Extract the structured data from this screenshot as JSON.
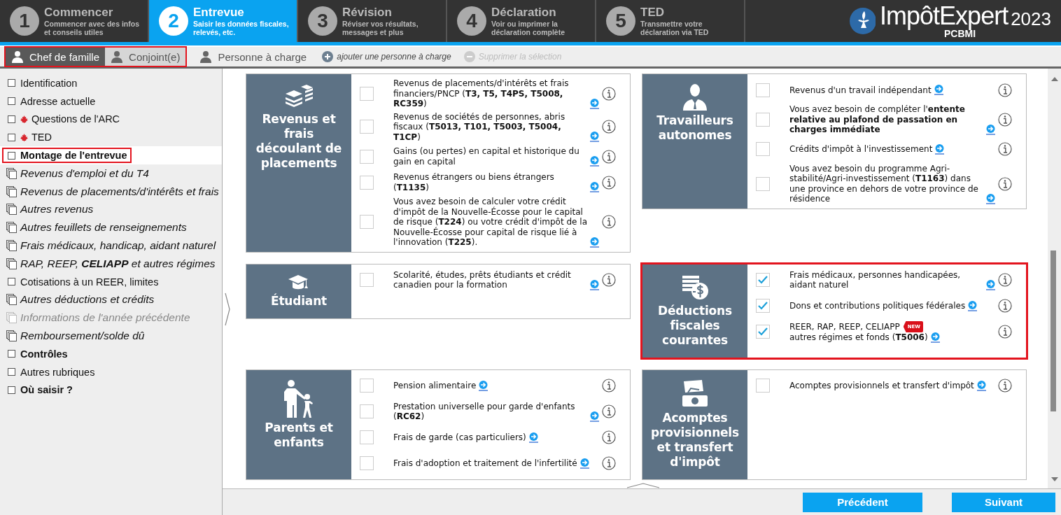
{
  "steps": [
    {
      "number": "1",
      "title": "Commencer",
      "subtitle": "Commencer avec des infos et conseils utiles",
      "selected": false
    },
    {
      "number": "2",
      "title": "Entrevue",
      "subtitle": "Saisir les données fiscales, relevés, etc.",
      "selected": true
    },
    {
      "number": "3",
      "title": "Révision",
      "subtitle": "Réviser vos résultats, messages et plus",
      "selected": false
    },
    {
      "number": "4",
      "title": "Déclaration",
      "subtitle": "Voir ou imprimer la déclaration complète",
      "selected": false
    },
    {
      "number": "5",
      "title": "TED",
      "subtitle": "Transmettre votre déclaration via TED",
      "selected": false
    }
  ],
  "logo": {
    "name": "ImpôtExpert",
    "sub": "PCBMI",
    "year": "2023"
  },
  "person_tabs": [
    {
      "label": "Chef de famille",
      "kind": "member",
      "selected": true,
      "highlighted": true
    },
    {
      "label": "Conjoint(e)",
      "kind": "member",
      "selected": false,
      "highlighted": true
    },
    {
      "label": "Personne à charge",
      "kind": "dependent",
      "selected": false,
      "highlighted": false
    }
  ],
  "person_actions": [
    {
      "label": "ajouter une personne à charge",
      "kind": "add",
      "disabled": false
    },
    {
      "label": "Supprimer la sélection",
      "kind": "remove",
      "disabled": true
    }
  ],
  "sidebar": [
    {
      "label": "Identification",
      "kind": "page",
      "bold": false,
      "flag": false,
      "disabled": false,
      "selected": false,
      "highlighted": false
    },
    {
      "label": "Adresse actuelle",
      "kind": "page",
      "bold": false,
      "flag": false,
      "disabled": false,
      "selected": false,
      "highlighted": false
    },
    {
      "label": "Questions de l'ARC",
      "kind": "page",
      "bold": false,
      "flag": true,
      "disabled": false,
      "selected": false,
      "highlighted": false
    },
    {
      "label": "TED",
      "kind": "page",
      "bold": false,
      "flag": true,
      "disabled": false,
      "selected": false,
      "highlighted": false
    },
    {
      "label": "Montage de l'entrevue",
      "kind": "page",
      "bold": true,
      "flag": false,
      "disabled": false,
      "selected": true,
      "highlighted": true
    },
    {
      "label": "Revenus d'emploi et du T4",
      "kind": "multi",
      "bold": false,
      "flag": false,
      "disabled": false,
      "selected": false,
      "highlighted": false
    },
    {
      "label": "Revenus de placements/d'intérêts et frais",
      "kind": "multi",
      "bold": false,
      "flag": false,
      "disabled": false,
      "selected": false,
      "highlighted": false
    },
    {
      "label": "Autres revenus",
      "kind": "multi",
      "bold": false,
      "flag": false,
      "disabled": false,
      "selected": false,
      "highlighted": false
    },
    {
      "label": "Autres feuillets de renseignements",
      "kind": "multi",
      "bold": false,
      "flag": false,
      "disabled": false,
      "selected": false,
      "highlighted": false
    },
    {
      "label": "Frais médicaux, handicap, aidant naturel",
      "kind": "multi",
      "bold": false,
      "flag": false,
      "disabled": false,
      "selected": false,
      "highlighted": false
    },
    {
      "label": "RAP, REEP, **CELIAPP** et autres régimes",
      "kind": "multi",
      "bold": false,
      "flag": false,
      "disabled": false,
      "selected": false,
      "highlighted": false
    },
    {
      "label": "Cotisations à un REER, limites",
      "kind": "page",
      "bold": false,
      "flag": false,
      "disabled": false,
      "selected": false,
      "highlighted": false
    },
    {
      "label": "Autres déductions et crédits",
      "kind": "multi",
      "bold": false,
      "flag": false,
      "disabled": false,
      "selected": false,
      "highlighted": false
    },
    {
      "label": "Informations de l'année précédente",
      "kind": "multi",
      "bold": false,
      "flag": false,
      "disabled": true,
      "selected": false,
      "highlighted": false
    },
    {
      "label": "Remboursement/solde dû",
      "kind": "multi",
      "bold": false,
      "flag": false,
      "disabled": false,
      "selected": false,
      "highlighted": false
    },
    {
      "label": "Contrôles",
      "kind": "page",
      "bold": true,
      "flag": false,
      "disabled": false,
      "selected": false,
      "highlighted": false
    },
    {
      "label": "Autres rubriques",
      "kind": "page",
      "bold": false,
      "flag": false,
      "disabled": false,
      "selected": false,
      "highlighted": false
    },
    {
      "label": "Où saisir ?",
      "kind": "page",
      "bold": true,
      "flag": false,
      "disabled": false,
      "selected": false,
      "highlighted": false
    }
  ],
  "cards": [
    {
      "title": "Revenus et frais découlant de placements",
      "highlighted": false,
      "rows": [
        {
          "text": "Revenus de placements/d'intérêts et frais financiers/PNCP (**T3, T5, T4PS, T5008, RC359**)",
          "checked": false
        },
        {
          "text": "Revenus de sociétés de personnes, abris fiscaux (**T5013, T101, T5003, T5004, T1CP**)",
          "checked": false
        },
        {
          "text": "Gains (ou pertes) en capital et historique du gain en capital",
          "checked": false
        },
        {
          "text": "Revenus étrangers ou biens étrangers (**T1135**)",
          "checked": false
        },
        {
          "text": "Vous avez besoin de calculer votre crédit d'impôt de la Nouvelle-Écosse pour le capital de risque (**T224**) ou votre crédit d'impôt de la Nouvelle-Écosse pour capital de risque lié à l'innovation (**T225**).",
          "checked": false
        }
      ]
    },
    {
      "title": "Travailleurs autonomes",
      "highlighted": false,
      "rows": [
        {
          "text": "Revenus d'un travail indépendant",
          "checked": false
        },
        {
          "text": "Vous avez besoin de compléter l'**entente relative au plafond de passation en charges immédiate**",
          "checked": false
        },
        {
          "text": "Crédits d'impôt à l'investissement",
          "checked": false
        },
        {
          "text": "Vous avez besoin du programme Agri-stabilité/Agri-investissement (**T1163**) dans une province en dehors de votre province de résidence",
          "checked": false
        }
      ]
    },
    {
      "title": "Étudiant",
      "highlighted": false,
      "rows": [
        {
          "text": "Scolarité, études, prêts étudiants et crédit canadien pour la formation",
          "checked": false
        }
      ]
    },
    {
      "title": "Déductions fiscales courantes",
      "highlighted": true,
      "rows": [
        {
          "text": "Frais médicaux, personnes handicapées, aidant naturel",
          "checked": true
        },
        {
          "text": "Dons et contributions politiques fédérales",
          "checked": true
        },
        {
          "text": "REER, RAP, REEP, CELIAPP",
          "badge": "NEW",
          "text_2": "autres régimes et fonds (**T5006**)",
          "checked": true
        }
      ]
    },
    {
      "title": "Parents et enfants",
      "highlighted": false,
      "rows": [
        {
          "text": "Pension alimentaire",
          "checked": false
        },
        {
          "text": "Prestation universelle pour garde d'enfants (**RC62**)",
          "checked": false
        },
        {
          "text": "Frais de garde (cas particuliers)",
          "checked": false
        },
        {
          "text": "Frais d'adoption et traitement de l'infertilité",
          "checked": false
        }
      ]
    },
    {
      "title": "Acomptes provisionnels et transfert d'impôt",
      "highlighted": false,
      "rows": [
        {
          "text": "Acomptes provisionnels et transfert d'impôt",
          "checked": false
        }
      ]
    }
  ],
  "nav_buttons": [
    "Précédent",
    "Suivant"
  ]
}
